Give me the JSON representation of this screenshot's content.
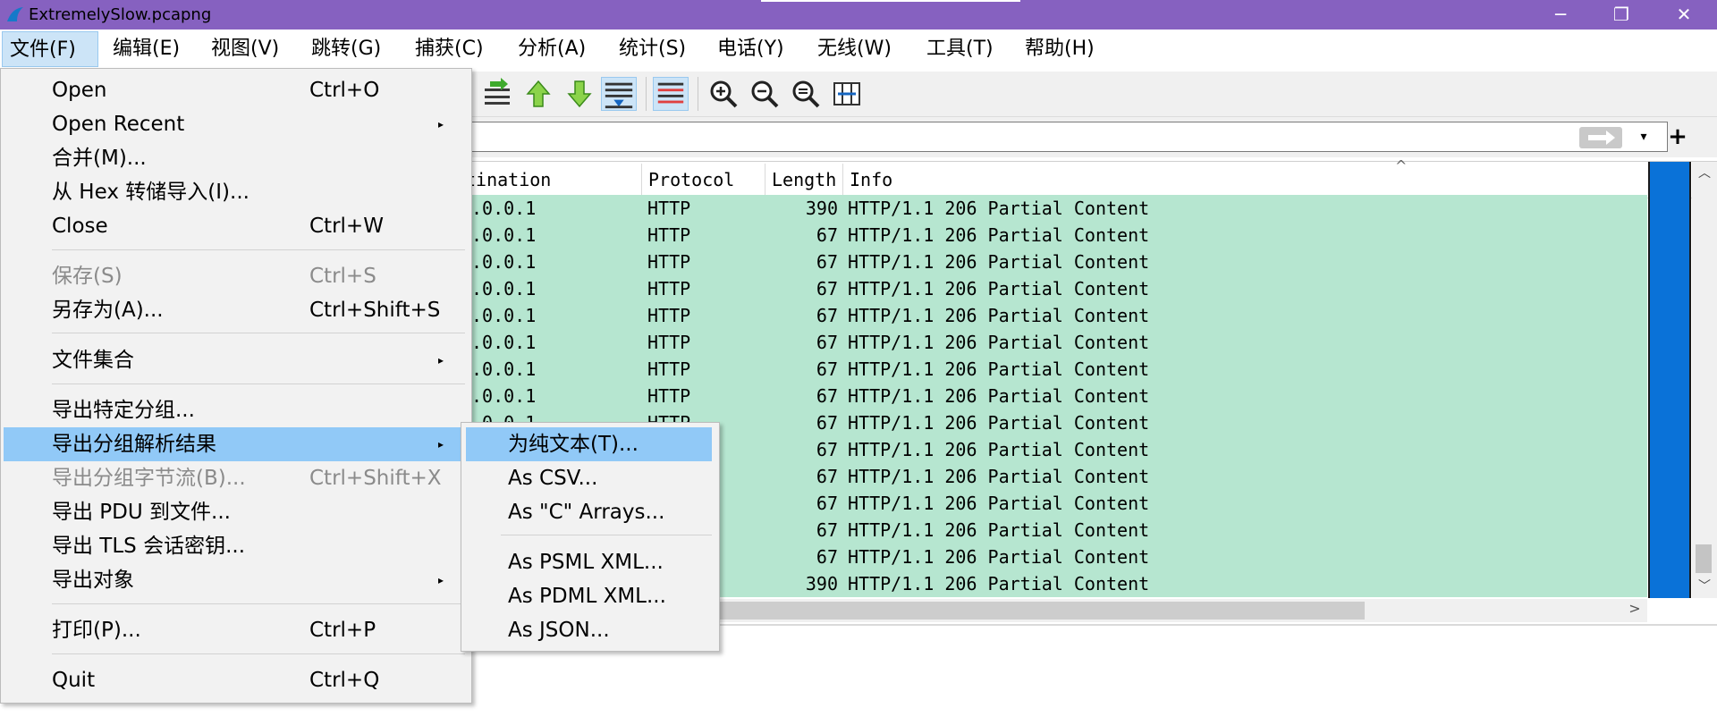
{
  "window": {
    "title": "ExtremelySlow.pcapng",
    "minimize": "─",
    "restore": "❐",
    "close": "✕"
  },
  "menubar": [
    {
      "label": "文件(F)"
    },
    {
      "label": "编辑(E)"
    },
    {
      "label": "视图(V)"
    },
    {
      "label": "跳转(G)"
    },
    {
      "label": "捕获(C)"
    },
    {
      "label": "分析(A)"
    },
    {
      "label": "统计(S)"
    },
    {
      "label": "电话(Y)"
    },
    {
      "label": "无线(W)"
    },
    {
      "label": "工具(T)"
    },
    {
      "label": "帮助(H)"
    }
  ],
  "filter": {
    "placeholder": "",
    "dropdown": "▾",
    "add": "+"
  },
  "packet_list": {
    "columns": {
      "destination": "tination",
      "protocol": "Protocol",
      "length": "Length",
      "info": "Info"
    },
    "rows": [
      {
        "dst": ".0.0.1",
        "proto": "HTTP",
        "len": "390",
        "info": "HTTP/1.1 206 Partial Content"
      },
      {
        "dst": ".0.0.1",
        "proto": "HTTP",
        "len": "67",
        "info": "HTTP/1.1 206 Partial Content"
      },
      {
        "dst": ".0.0.1",
        "proto": "HTTP",
        "len": "67",
        "info": "HTTP/1.1 206 Partial Content"
      },
      {
        "dst": ".0.0.1",
        "proto": "HTTP",
        "len": "67",
        "info": "HTTP/1.1 206 Partial Content"
      },
      {
        "dst": ".0.0.1",
        "proto": "HTTP",
        "len": "67",
        "info": "HTTP/1.1 206 Partial Content"
      },
      {
        "dst": ".0.0.1",
        "proto": "HTTP",
        "len": "67",
        "info": "HTTP/1.1 206 Partial Content"
      },
      {
        "dst": ".0.0.1",
        "proto": "HTTP",
        "len": "67",
        "info": "HTTP/1.1 206 Partial Content"
      },
      {
        "dst": ".0.0.1",
        "proto": "HTTP",
        "len": "67",
        "info": "HTTP/1.1 206 Partial Content"
      },
      {
        "dst": ".0.0.1",
        "proto": "HTTP",
        "len": "67",
        "info": "HTTP/1.1 206 Partial Content"
      },
      {
        "dst": "",
        "proto": "",
        "len": "67",
        "info": "HTTP/1.1 206 Partial Content"
      },
      {
        "dst": "",
        "proto": "",
        "len": "67",
        "info": "HTTP/1.1 206 Partial Content"
      },
      {
        "dst": "",
        "proto": "",
        "len": "67",
        "info": "HTTP/1.1 206 Partial Content"
      },
      {
        "dst": "",
        "proto": "",
        "len": "67",
        "info": "HTTP/1.1 206 Partial Content"
      },
      {
        "dst": "",
        "proto": "",
        "len": "67",
        "info": "HTTP/1.1 206 Partial Content"
      },
      {
        "dst": "",
        "proto": "",
        "len": "390",
        "info": "HTTP/1.1 206 Partial Content"
      }
    ]
  },
  "file_menu": {
    "items": [
      {
        "label": "Open",
        "shortcut": "Ctrl+O"
      },
      {
        "label": "Open Recent",
        "arrow": "▸"
      },
      {
        "label": "合并(M)..."
      },
      {
        "label": "从 Hex 转储导入(I)..."
      },
      {
        "label": "Close",
        "shortcut": "Ctrl+W"
      },
      {
        "label": "保存(S)",
        "shortcut": "Ctrl+S"
      },
      {
        "label": "另存为(A)...",
        "shortcut": "Ctrl+Shift+S"
      },
      {
        "label": "文件集合",
        "arrow": "▸"
      },
      {
        "label": "导出特定分组..."
      },
      {
        "label": "导出分组解析结果",
        "arrow": "▸"
      },
      {
        "label": "导出分组字节流(B)...",
        "shortcut": "Ctrl+Shift+X"
      },
      {
        "label": "导出 PDU 到文件..."
      },
      {
        "label": "导出 TLS 会话密钥..."
      },
      {
        "label": "导出对象",
        "arrow": "▸"
      },
      {
        "label": "打印(P)...",
        "shortcut": "Ctrl+P"
      },
      {
        "label": "Quit",
        "shortcut": "Ctrl+Q"
      }
    ]
  },
  "export_submenu": {
    "items": [
      {
        "label": "为纯文本(T)..."
      },
      {
        "label": "As CSV..."
      },
      {
        "label": "As \"C\" Arrays..."
      },
      {
        "label": "As PSML XML..."
      },
      {
        "label": "As PDML XML..."
      },
      {
        "label": "As JSON..."
      }
    ]
  },
  "colors": {
    "titlebar": "#8661c0",
    "row_bg": "#b6e6d0",
    "menu_highlight": "#91c9f7",
    "minimap": "#0a72d8"
  }
}
